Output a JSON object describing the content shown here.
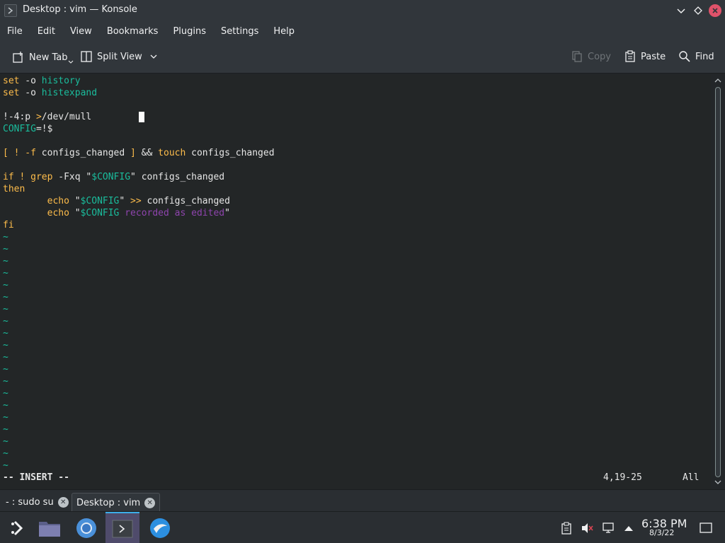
{
  "window": {
    "title": "Desktop : vim — Konsole"
  },
  "menu": [
    "File",
    "Edit",
    "View",
    "Bookmarks",
    "Plugins",
    "Settings",
    "Help"
  ],
  "toolbar": {
    "new_tab": "New Tab",
    "split_view": "Split View",
    "copy": "Copy",
    "paste": "Paste",
    "find": "Find"
  },
  "editor": {
    "lines": [
      [
        {
          "t": "set",
          "c": "yellow"
        },
        {
          "t": " -o ",
          "c": "white"
        },
        {
          "t": "history",
          "c": "teal"
        }
      ],
      [
        {
          "t": "set",
          "c": "yellow"
        },
        {
          "t": " -o ",
          "c": "white"
        },
        {
          "t": "histexpand",
          "c": "teal"
        }
      ],
      [],
      [
        {
          "t": "!-4:p ",
          "c": "white"
        },
        {
          "t": ">",
          "c": "yellow"
        },
        {
          "t": "/dev/mull",
          "c": "white"
        }
      ],
      [
        {
          "t": "CONFIG",
          "c": "teal"
        },
        {
          "t": "=!$",
          "c": "white"
        }
      ],
      [],
      [
        {
          "t": "[ ! -f",
          "c": "yellow"
        },
        {
          "t": " configs_changed ",
          "c": "white"
        },
        {
          "t": "]",
          "c": "yellow"
        },
        {
          "t": " && ",
          "c": "white"
        },
        {
          "t": "touch",
          "c": "yellow"
        },
        {
          "t": " configs_changed",
          "c": "white"
        }
      ],
      [],
      [
        {
          "t": "if",
          "c": "yellow"
        },
        {
          "t": " ",
          "c": "white"
        },
        {
          "t": "!",
          "c": "yellow"
        },
        {
          "t": " ",
          "c": "white"
        },
        {
          "t": "grep",
          "c": "yellow"
        },
        {
          "t": " -Fxq \"",
          "c": "white"
        },
        {
          "t": "$CONFIG",
          "c": "teal"
        },
        {
          "t": "\" configs_changed",
          "c": "white"
        }
      ],
      [
        {
          "t": "then",
          "c": "yellow"
        }
      ],
      [
        {
          "t": "        ",
          "c": "white"
        },
        {
          "t": "echo",
          "c": "yellow"
        },
        {
          "t": " \"",
          "c": "white"
        },
        {
          "t": "$CONFIG",
          "c": "teal"
        },
        {
          "t": "\" ",
          "c": "white"
        },
        {
          "t": ">>",
          "c": "yellow"
        },
        {
          "t": " configs_changed",
          "c": "white"
        }
      ],
      [
        {
          "t": "        ",
          "c": "white"
        },
        {
          "t": "echo",
          "c": "yellow"
        },
        {
          "t": " \"",
          "c": "white"
        },
        {
          "t": "$CONFIG",
          "c": "teal"
        },
        {
          "t": " recorded as edited",
          "c": "purple"
        },
        {
          "t": "\"",
          "c": "white"
        }
      ],
      [
        {
          "t": "fi",
          "c": "yellow"
        }
      ]
    ],
    "tilde_count": 20,
    "tilde_char": "~",
    "mode": "-- INSERT --",
    "position": "4,19-25",
    "scroll_pos": "All"
  },
  "tabs": [
    {
      "label": "- : sudo su",
      "active": false
    },
    {
      "label": "Desktop : vim",
      "active": true
    }
  ],
  "tray": {
    "time": "6:38 PM",
    "date": "8/3/22"
  },
  "colors": {
    "yellow": "#fdbc4b",
    "teal": "#1abc9c",
    "purple": "#8e44ad",
    "accent": "#3daee9"
  }
}
